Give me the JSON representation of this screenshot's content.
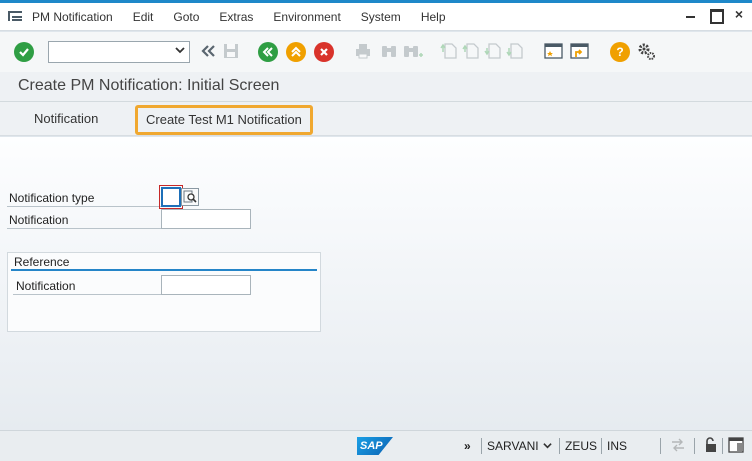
{
  "menu": {
    "items": [
      "PM Notification",
      "Edit",
      "Goto",
      "Extras",
      "Environment",
      "System",
      "Help"
    ]
  },
  "window": {
    "minimize": "minimize-icon",
    "maximize": "maximize-icon",
    "close": "×"
  },
  "toolbar": {
    "command_field_value": "",
    "icons": [
      "enter-check-icon",
      "command-dropdown",
      "collapse-double-arrow-icon",
      "save-icon",
      "back-icon",
      "exit-icon",
      "cancel-icon",
      "print-icon",
      "find-icon",
      "find-next-icon",
      "first-page-icon",
      "previous-page-icon",
      "next-page-icon",
      "last-page-icon",
      "create-session-icon",
      "shortcut-icon",
      "help-icon",
      "customize-layout-icon"
    ],
    "colors": {
      "green": "#2f9e44",
      "yellow": "#f0a000",
      "red": "#d9332b"
    }
  },
  "title": "Create PM Notification: Initial Screen",
  "app_toolbar": {
    "btn_notification": "Notification",
    "btn_create_test": "Create Test M1 Notification",
    "highlight_color": "#f0a830"
  },
  "form": {
    "notification_type_label": "Notification type",
    "notification_type_value": "",
    "notification_label": "Notification",
    "notification_value": "",
    "reference_title": "Reference",
    "reference_notification_label": "Notification",
    "reference_notification_value": ""
  },
  "statusbar": {
    "logo": "SAP",
    "arrows": "»",
    "user": "SARVANI",
    "system": "ZEUS",
    "mode": "INS"
  }
}
